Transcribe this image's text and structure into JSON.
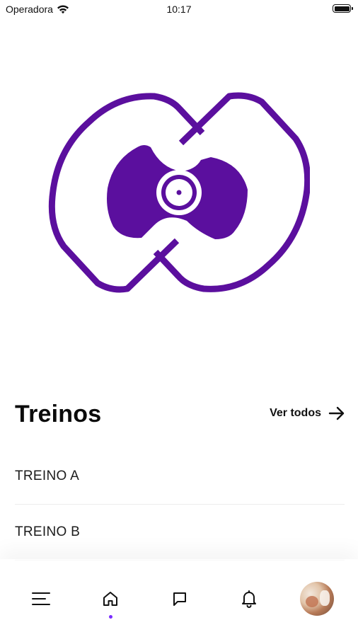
{
  "status_bar": {
    "carrier": "Operadora",
    "time": "10:17",
    "icons": [
      "wifi-icon",
      "battery-icon"
    ]
  },
  "logo": {
    "icon": "vinyl-record-logo",
    "brand_color": "#5b0f9e"
  },
  "section": {
    "title": "Treinos",
    "see_all_label": "Ver todos",
    "see_all_icon": "arrow-right-icon"
  },
  "workouts": [
    {
      "label": "TREINO A"
    },
    {
      "label": "TREINO B"
    }
  ],
  "bottom_nav": {
    "items": [
      {
        "icon": "menu-icon"
      },
      {
        "icon": "home-icon",
        "active": true
      },
      {
        "icon": "chat-icon"
      },
      {
        "icon": "bell-icon"
      },
      {
        "icon": "avatar"
      }
    ],
    "active_color": "#7b2cff"
  }
}
